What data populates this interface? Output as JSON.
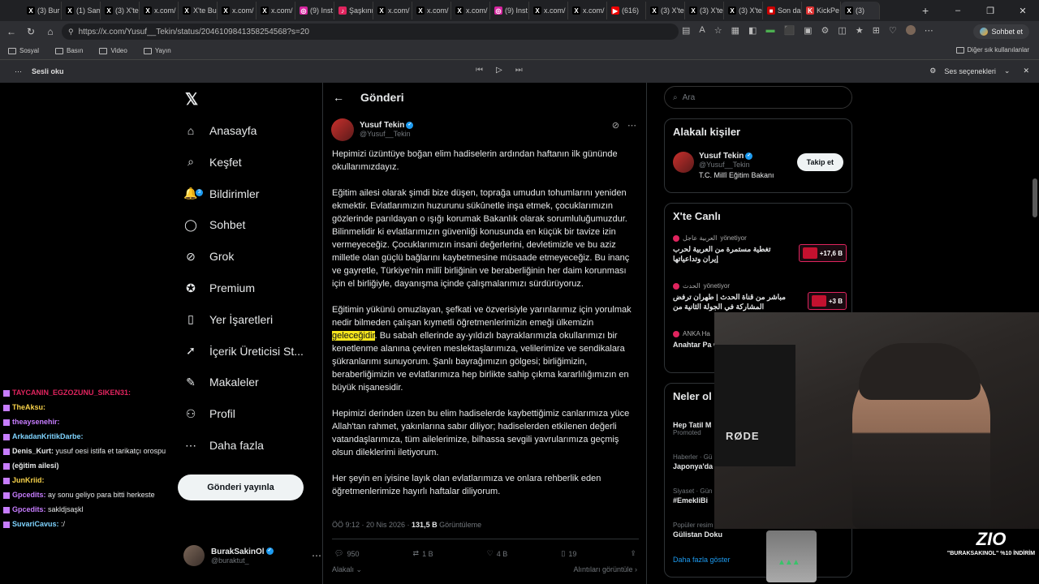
{
  "browser": {
    "tabs": [
      {
        "label": "(3) Bur",
        "icon": "x"
      },
      {
        "label": "(1) Sam",
        "icon": "x"
      },
      {
        "label": "(3) X'te",
        "icon": "x"
      },
      {
        "label": "x.com/",
        "icon": "x"
      },
      {
        "label": "X'te Bu",
        "icon": "x"
      },
      {
        "label": "x.com/",
        "icon": "x"
      },
      {
        "label": "x.com/",
        "icon": "x"
      },
      {
        "label": "(9) Inst",
        "icon": "instagram"
      },
      {
        "label": "Şaşkını",
        "icon": "tiktok"
      },
      {
        "label": "x.com/",
        "icon": "x"
      },
      {
        "label": "x.com/",
        "icon": "x"
      },
      {
        "label": "x.com/",
        "icon": "x"
      },
      {
        "label": "(9) Inst",
        "icon": "instagram"
      },
      {
        "label": "x.com/",
        "icon": "x"
      },
      {
        "label": "x.com/",
        "icon": "x"
      },
      {
        "label": "(616)",
        "icon": "youtube"
      },
      {
        "label": "(3) X'te",
        "icon": "x"
      },
      {
        "label": "(3) X'te",
        "icon": "x"
      },
      {
        "label": "(3) X'te",
        "icon": "x"
      },
      {
        "label": "Son da",
        "icon": "news"
      },
      {
        "label": "KickPe",
        "icon": "kick"
      },
      {
        "label": "(3)",
        "icon": "x"
      }
    ],
    "url": "https://x.com/Yusuf__Tekin/status/2046109841358254568?s=20",
    "chat_button": "Sohbet et",
    "bookmarks": [
      "Sosyal",
      "Basın",
      "Video",
      "Yayın"
    ],
    "bookmarks_other": "Diğer sık kullanılanlar",
    "read_aloud": "Sesli oku",
    "voice_options": "Ses seçenekleri"
  },
  "nav": {
    "items": [
      {
        "label": "Anasayfa",
        "icon": "home-icon",
        "glyph": "⌂"
      },
      {
        "label": "Keşfet",
        "icon": "search-icon",
        "glyph": "⌕"
      },
      {
        "label": "Bildirimler",
        "icon": "bell-icon",
        "glyph": "🔔"
      },
      {
        "label": "Sohbet",
        "icon": "chat-icon",
        "glyph": "◯"
      },
      {
        "label": "Grok",
        "icon": "grok-icon",
        "glyph": "⊘"
      },
      {
        "label": "Premium",
        "icon": "premium-icon",
        "glyph": "✪"
      },
      {
        "label": "Yer İşaretleri",
        "icon": "bookmark-icon",
        "glyph": "▯"
      },
      {
        "label": "İçerik Üreticisi St...",
        "icon": "rocket-icon",
        "glyph": "➚"
      },
      {
        "label": "Makaleler",
        "icon": "article-icon",
        "glyph": "✎"
      },
      {
        "label": "Profil",
        "icon": "profile-icon",
        "glyph": "⚇"
      },
      {
        "label": "Daha fazla",
        "icon": "more-icon",
        "glyph": "⋯"
      }
    ],
    "notification_badge": "3",
    "post_button": "Gönderi yayınla",
    "account": {
      "name": "BurakSakinOl",
      "handle": "@buraktut_"
    }
  },
  "post": {
    "header": "Gönderi",
    "author_name": "Yusuf Tekin",
    "author_handle": "@Yusuf__Tekin",
    "p1": "Hepimizi üzüntüye boğan elim hadiselerin ardından haftanın ilk gününde okullarımızdayız.",
    "p2": "Eğitim ailesi olarak şimdi bize düşen, toprağa umudun tohumlarını yeniden ekmektir. Evlatlarımızın huzurunu sükûnetle inşa etmek, çocuklarımızın gözlerinde parıldayan o ışığı korumak Bakanlık olarak sorumluluğumuzdur. Bilinmelidir ki evlatlarımızın güvenliği konusunda en küçük bir tavize izin vermeyeceğiz. Çocuklarımızın insani değerlerini, devletimizle ve bu aziz milletle olan güçlü bağlarını kaybetmesine müsaade etmeyeceğiz. Bu inanç ve gayretle, Türkiye'nin millî birliğinin ve beraberliğinin her daim korunması için el birliğiyle, dayanışma içinde çalışmalarımızı sürdürüyoruz.",
    "p3_before": "Eğitimin yükünü omuzlayan, şefkati ve özverisiyle yarınlarımız için yorulmak nedir bilmeden çalışan kıymetli öğretmenlerimizin emeği ülkemizin ",
    "p3_highlight": "geleceğidir",
    "p3_after": ". Bu sabah ellerinde ay-yıldızlı bayraklarımızla okullarımızı bir kenetlenme alanına çeviren meslektaşlarımıza, velilerimize ve sendikalara şükranlarımı sunuyorum. Şanlı bayrağımızın gölgesi; birliğimizin, beraberliğimizin ve evlatlarımıza hep birlikte sahip çıkma kararlılığımızın en büyük nişanesidir.",
    "p4": "Hepimizi derinden üzen bu elim hadiselerde kaybettiğimiz canlarımıza yüce Allah'tan rahmet, yakınlarına sabır diliyor; hadiselerden etkilenen değerli vatandaşlarımıza, tüm ailelerimize, bilhassa sevgili yavrularımıza geçmiş olsun dileklerimi iletiyorum.",
    "p5": "Her şeyin en iyisine layık olan evlatlarımıza ve onlara rehberlik eden öğretmenlerimize hayırlı haftalar diliyorum.",
    "time": "ÖÖ 9:12 · 20 Nis 2026 · ",
    "views": "131,5 B",
    "views_label": " Görüntüleme",
    "replies": "950",
    "reposts": "1 B",
    "likes": "4 B",
    "bookmarks": "19",
    "filter_left": "Alakalı",
    "filter_right": "Alıntıları görüntüle"
  },
  "sidebar": {
    "search_placeholder": "Ara",
    "related_title": "Alakalı kişiler",
    "related_name": "Yusuf Tekin",
    "related_handle": "@Yusuf__Tekin",
    "related_bio": "T.C. Millî Eğitim Bakanı",
    "follow": "Takip et",
    "live_title": "X'te Canlı",
    "live": [
      {
        "source": "العربية عاجل",
        "status": "yönetiyor",
        "title": "تغطية مستمرة من العربية لحرب إيران وتداعياتها",
        "count": "+17,6 B"
      },
      {
        "source": "الحدث",
        "status": "yönetiyor",
        "title": "مباشر من قناة الحدث | طهران ترفض المشاركة في الجولة الثانية من",
        "count": "+3 B"
      },
      {
        "source": "ANKA Ha",
        "status": "",
        "title": "Anahtar Pa Geçen, par",
        "count": ""
      }
    ],
    "trends_title": "Neler ol",
    "trends": [
      {
        "context": "",
        "name": "Hep Tatil M",
        "extra": "Promoted"
      },
      {
        "context": "Haberler · Gü",
        "name": "Japonya'da",
        "extra": ""
      },
      {
        "context": "Siyaset · Gün",
        "name": "#EmekliBi",
        "extra": ""
      },
      {
        "context": "Popüler resim",
        "name": "Gülistan Doku",
        "extra": ""
      }
    ],
    "show_more": "Daha fazla göster"
  },
  "chat": [
    {
      "user": "TAYCANIN_EGZOZUNU_SIKEN31:",
      "msg": "",
      "color": "#e0245e"
    },
    {
      "user": "TheAksu:",
      "msg": "",
      "color": "#f7d24a"
    },
    {
      "user": "theaysenehir:",
      "msg": "",
      "color": "#c77dff"
    },
    {
      "user": "ArkadanKritikDarbe:",
      "msg": "",
      "color": "#7fd4ff"
    },
    {
      "user": "Denis_Kurt:",
      "msg": "yusuf oesi istifa et tarikatçı orospu",
      "color": "#e7e9ea"
    },
    {
      "user": "(eğitim ailesi)",
      "msg": "",
      "color": "#e7e9ea"
    },
    {
      "user": "JunKriid:",
      "msg": "",
      "color": "#f7d24a"
    },
    {
      "user": "Gpcedits:",
      "msg": "ay sonu geliyo para bitti herkeste",
      "color": "#c77dff"
    },
    {
      "user": "Gpcedits:",
      "msg": "sakldjsaşkl",
      "color": "#c77dff"
    },
    {
      "user": "SuvariCavus:",
      "msg": ":/",
      "color": "#7fd4ff"
    }
  ],
  "stream": {
    "mic_brand": "RØDE",
    "promo_logo": "ZIO",
    "promo_text": "\"BURAKSAKINOL\" %10 İNDİRİM"
  }
}
